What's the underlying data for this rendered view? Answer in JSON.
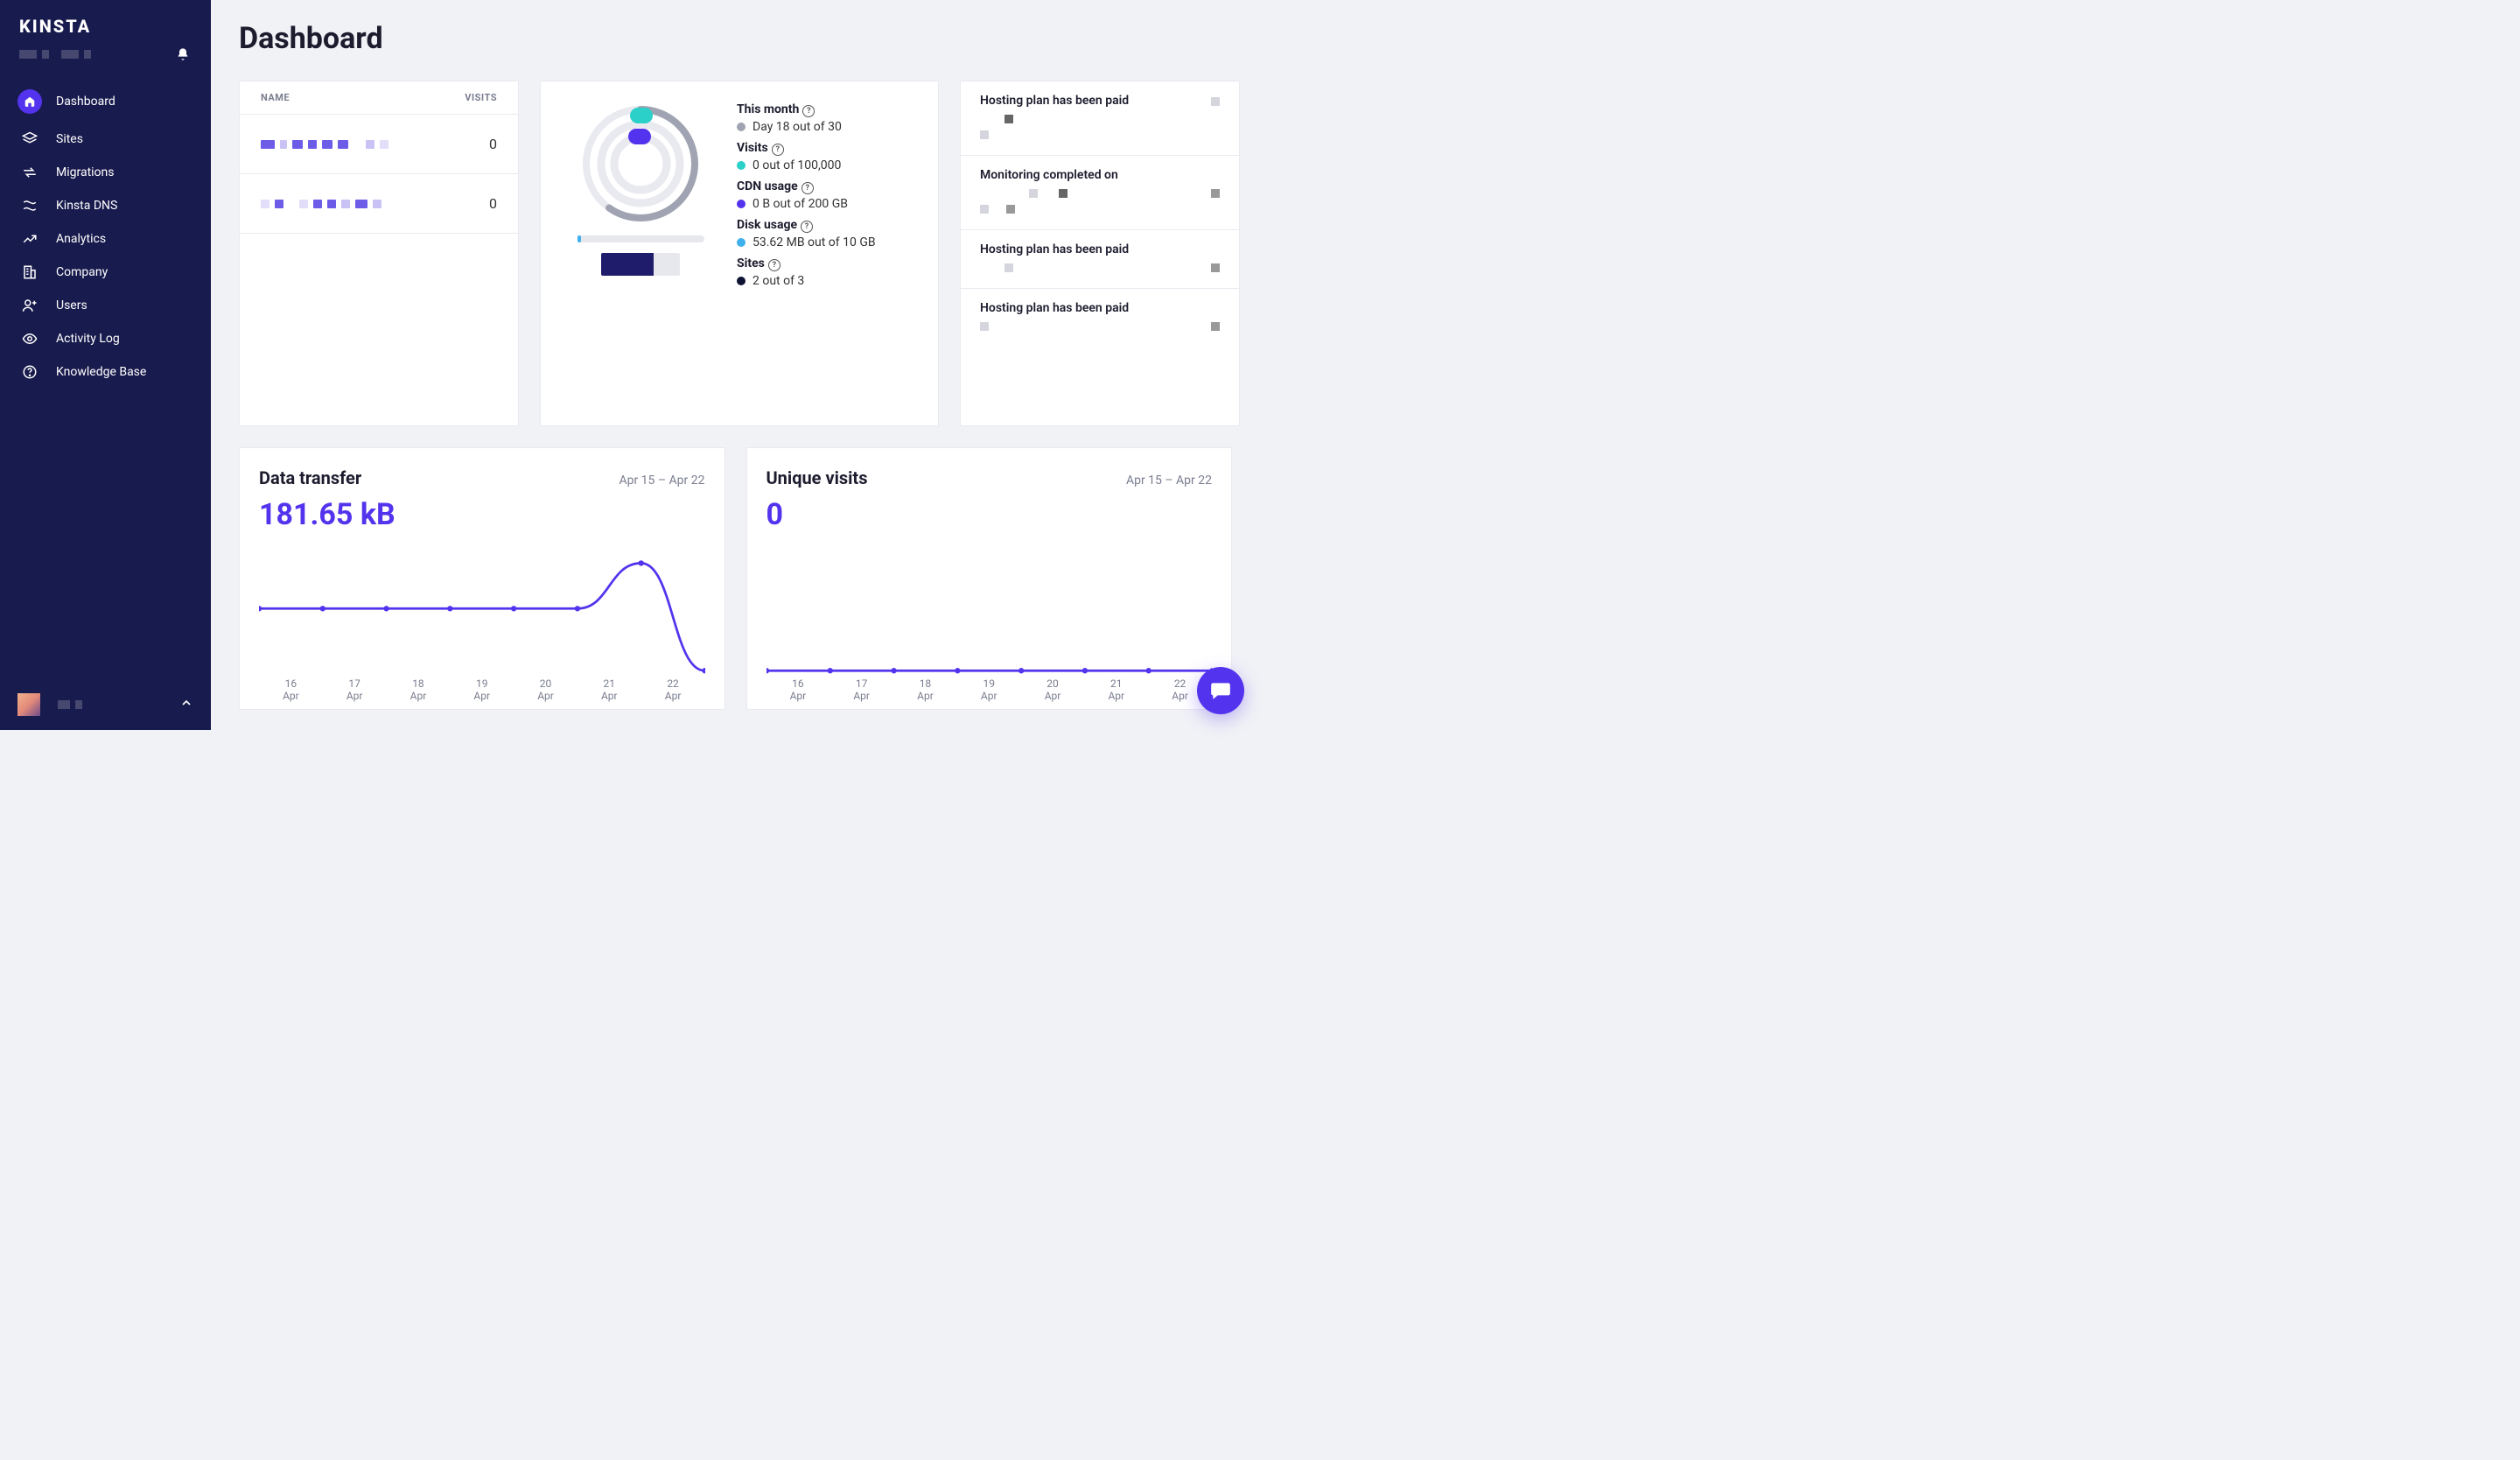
{
  "brand": "KINSTA",
  "page_title": "Dashboard",
  "sidebar": {
    "items": [
      {
        "label": "Dashboard",
        "icon": "house-icon",
        "active": true
      },
      {
        "label": "Sites",
        "icon": "layers-icon"
      },
      {
        "label": "Migrations",
        "icon": "transfer-icon"
      },
      {
        "label": "Kinsta DNS",
        "icon": "dns-icon"
      },
      {
        "label": "Analytics",
        "icon": "trending-icon"
      },
      {
        "label": "Company",
        "icon": "building-icon"
      },
      {
        "label": "Users",
        "icon": "user-plus-icon"
      },
      {
        "label": "Activity Log",
        "icon": "eye-icon"
      },
      {
        "label": "Knowledge Base",
        "icon": "question-circle-icon"
      }
    ]
  },
  "sites_table": {
    "col_name": "NAME",
    "col_visits": "VISITS",
    "rows": [
      {
        "visits": "0"
      },
      {
        "visits": "0"
      }
    ]
  },
  "usage": {
    "month": {
      "label": "This month",
      "value": "Day 18 out of 30",
      "color": "#A0A3B1",
      "pct": 60
    },
    "visits": {
      "label": "Visits",
      "value": "0 out of 100,000",
      "color": "#2BD0C9",
      "pct": 0
    },
    "cdn": {
      "label": "CDN usage",
      "value": "0 B out of 200 GB",
      "color": "#5333ED",
      "pct": 0
    },
    "disk": {
      "label": "Disk usage",
      "value": "53.62 MB out of 10 GB",
      "color": "#3FB0ED",
      "pct": 0.5
    },
    "sites": {
      "label": "Sites",
      "value": "2 out of 3",
      "color": "#0F1333",
      "used": 2,
      "total": 3
    }
  },
  "notifications": [
    {
      "text": "Hosting plan has been paid"
    },
    {
      "text": "Monitoring completed on"
    },
    {
      "text": "Hosting plan has been paid"
    },
    {
      "text": "Hosting plan has been paid"
    }
  ],
  "transfer_chart": {
    "title": "Data transfer",
    "range": "Apr 15 – Apr 22",
    "value": "181.65 kB"
  },
  "visits_chart": {
    "title": "Unique visits",
    "range": "Apr 15 – Apr 22",
    "value": "0"
  },
  "x_labels": [
    "16\nApr",
    "17\nApr",
    "18\nApr",
    "19\nApr",
    "20\nApr",
    "21\nApr",
    "22\nApr"
  ],
  "chart_data": [
    {
      "type": "line",
      "title": "Data transfer",
      "range": "Apr 15 – Apr 22",
      "total": "181.65 kB",
      "x": [
        "Apr 15",
        "Apr 16",
        "Apr 17",
        "Apr 18",
        "Apr 19",
        "Apr 20",
        "Apr 21",
        "Apr 22"
      ],
      "y_unit": "kB",
      "y": [
        26,
        26,
        26,
        26,
        26,
        26,
        45,
        0
      ],
      "ylim": [
        0,
        50
      ]
    },
    {
      "type": "line",
      "title": "Unique visits",
      "range": "Apr 15 – Apr 22",
      "total": 0,
      "x": [
        "Apr 15",
        "Apr 16",
        "Apr 17",
        "Apr 18",
        "Apr 19",
        "Apr 20",
        "Apr 21",
        "Apr 22"
      ],
      "y": [
        0,
        0,
        0,
        0,
        0,
        0,
        0,
        0
      ],
      "ylim": [
        0,
        10
      ]
    },
    {
      "type": "gauge-composite",
      "title": "Resource usage",
      "series": [
        {
          "name": "This month",
          "value": 18,
          "max": 30,
          "unit": "day"
        },
        {
          "name": "Visits",
          "value": 0,
          "max": 100000,
          "unit": "visits"
        },
        {
          "name": "CDN usage",
          "value": 0,
          "max": 200,
          "unit": "GB"
        },
        {
          "name": "Disk usage",
          "value": 53.62,
          "max": 10240,
          "unit": "MB"
        },
        {
          "name": "Sites",
          "value": 2,
          "max": 3,
          "unit": "sites"
        }
      ]
    }
  ]
}
